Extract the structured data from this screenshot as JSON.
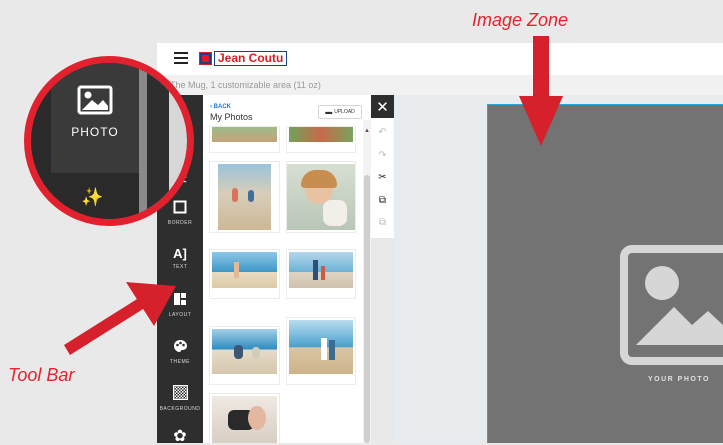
{
  "annotations": {
    "image_zone": "Image Zone",
    "tool_bar": "Tool Bar"
  },
  "header": {
    "menu_icon": "hamburger-icon",
    "logo_text": "Jean Coutu"
  },
  "product": {
    "subtitle": "The Mug, 1 customizable area (11 oz)"
  },
  "toolbar": {
    "items": [
      {
        "icon": "scissors-icon",
        "label": ""
      },
      {
        "icon": "border-icon",
        "label": "BORDER"
      },
      {
        "icon": "text-icon",
        "label": "TEXT",
        "glyph": "A]"
      },
      {
        "icon": "layout-icon",
        "label": "LAYOUT"
      },
      {
        "icon": "palette-icon",
        "label": "THEME"
      },
      {
        "icon": "background-icon",
        "label": "BACKGROUND"
      },
      {
        "icon": "gear-icon",
        "label": ""
      }
    ]
  },
  "zoom": {
    "photo_label": "PHOTO"
  },
  "panel": {
    "back_label": "BACK",
    "title": "My Photos",
    "upload_label": "UPLOAD"
  },
  "canvas": {
    "placeholder_label": "YOUR PHOTO"
  },
  "colors": {
    "annotation": "#e5232f",
    "toolbar_bg": "#2e2e2e",
    "image_zone": "#737373",
    "zone_border": "#29a3dc",
    "brand_red": "#d61f26",
    "brand_blue": "#1b3f8f"
  }
}
